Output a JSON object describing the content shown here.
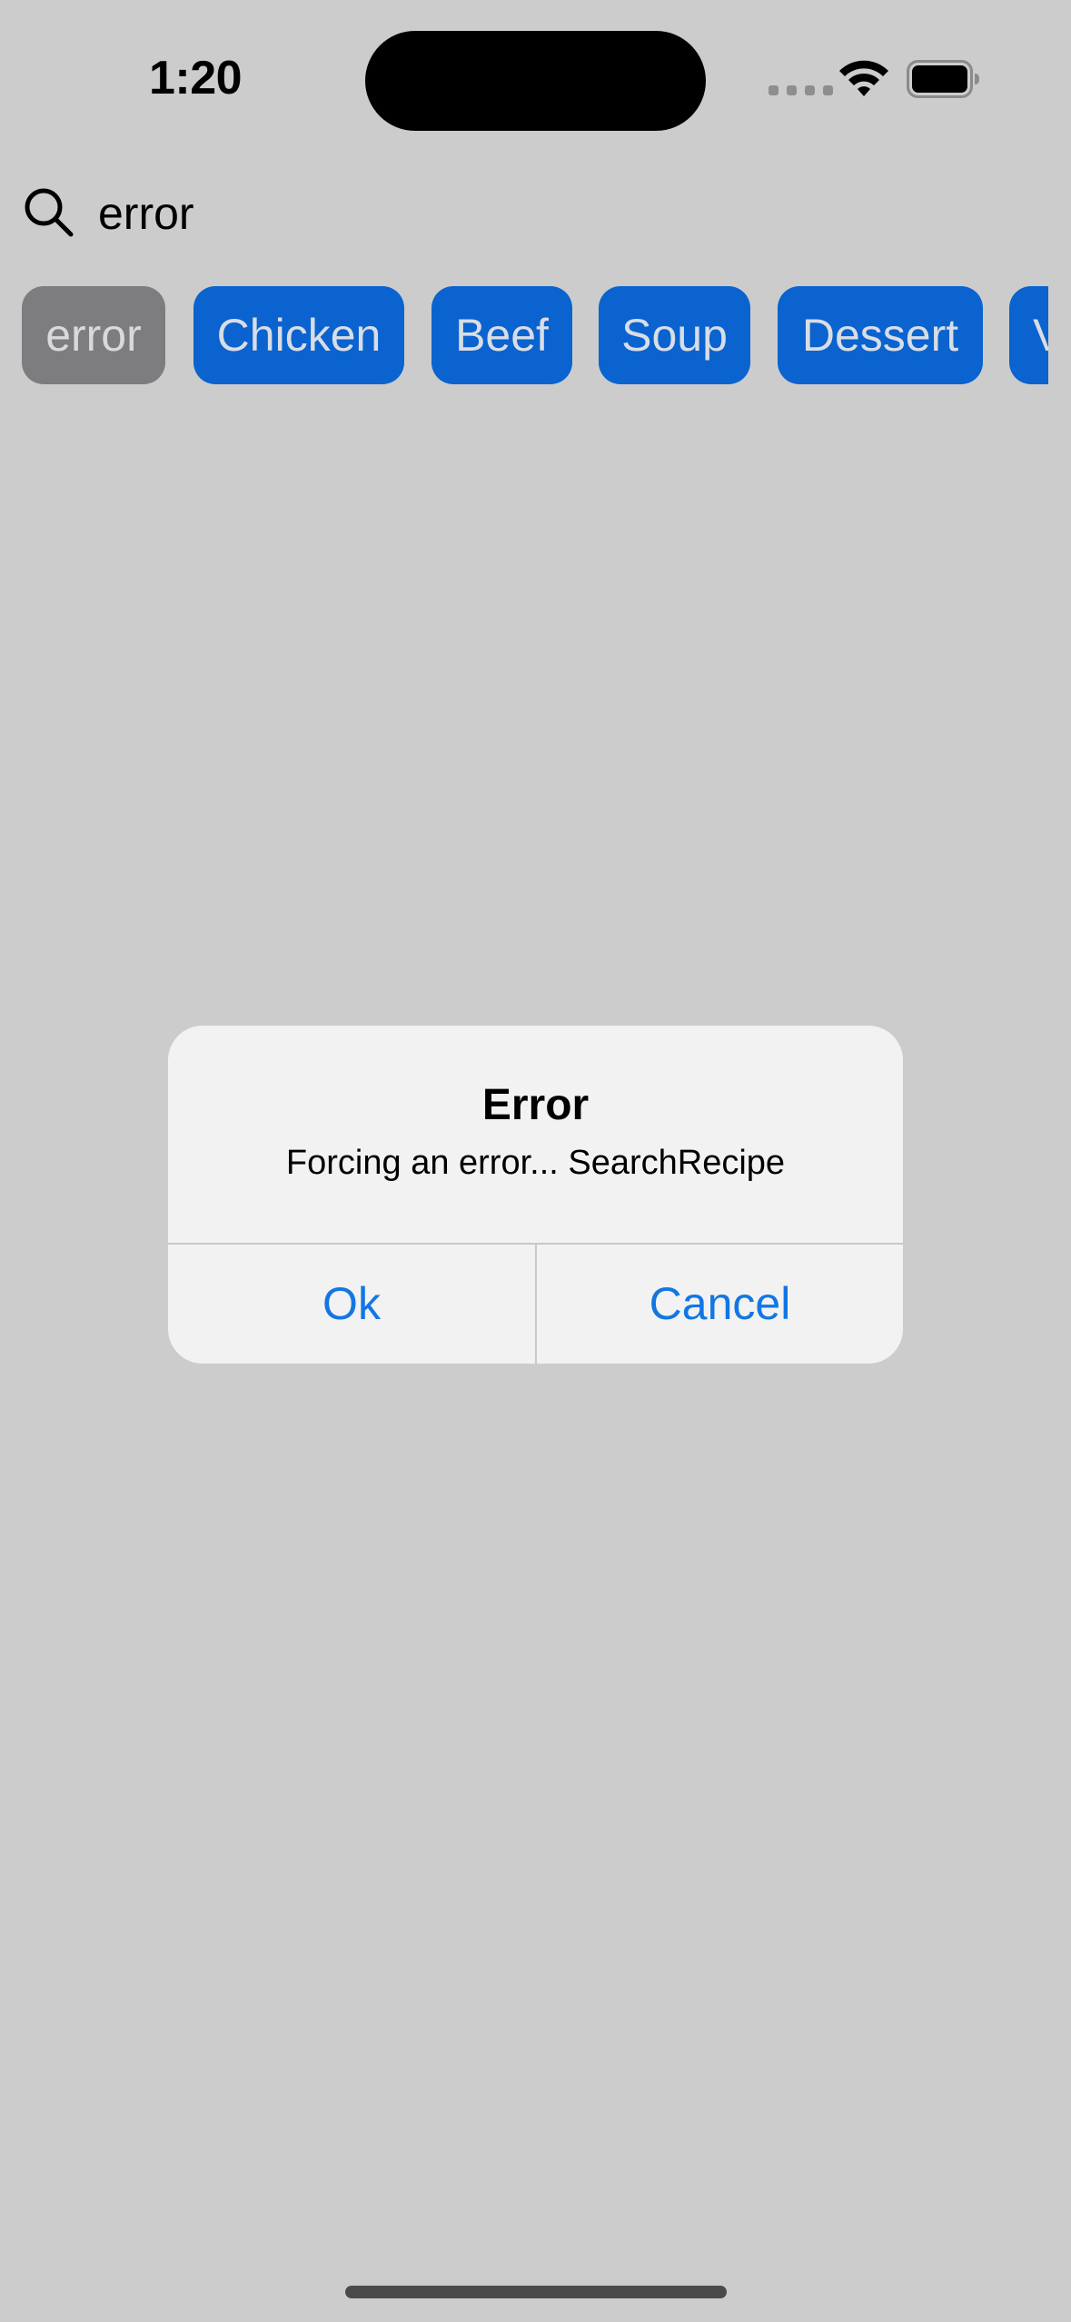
{
  "status_bar": {
    "time": "1:20",
    "icons": [
      "signal-dots-icon",
      "wifi-icon",
      "battery-icon"
    ]
  },
  "search": {
    "icon": "search-icon",
    "value": "error"
  },
  "chips": [
    {
      "label": "error",
      "selected": true
    },
    {
      "label": "Chicken",
      "selected": false
    },
    {
      "label": "Beef",
      "selected": false
    },
    {
      "label": "Soup",
      "selected": false
    },
    {
      "label": "Dessert",
      "selected": false
    },
    {
      "label": "V",
      "selected": false
    }
  ],
  "alert": {
    "title": "Error",
    "message": "Forcing an error... SearchRecipe",
    "ok_label": "Ok",
    "cancel_label": "Cancel"
  },
  "colors": {
    "background": "#cccccc",
    "chip_blue": "#0a63cf",
    "chip_selected": "#7d7d80",
    "alert_button_text": "#1276e5"
  }
}
